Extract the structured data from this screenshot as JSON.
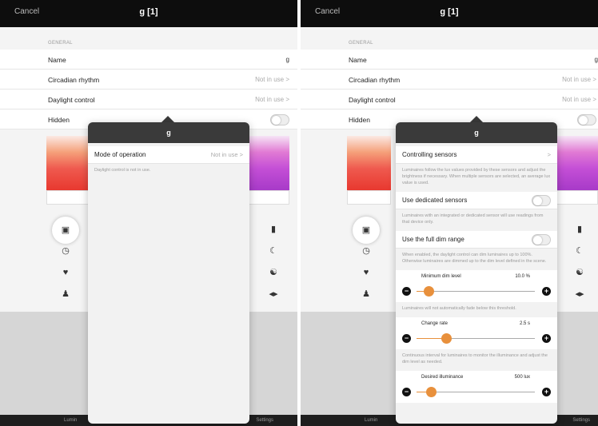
{
  "screens": [
    {
      "cancel": "Cancel",
      "title": "g [1]",
      "section": "GENERAL",
      "rows": [
        {
          "label": "Name",
          "value": "g"
        },
        {
          "label": "Circadian rhythm",
          "value": "Not in use >"
        },
        {
          "label": "Daylight control",
          "value": "Not in use >"
        },
        {
          "label": "Hidden",
          "value": ""
        }
      ],
      "tabs": {
        "left": "Lumin",
        "right": "Settings"
      },
      "popover": {
        "title": "g",
        "mode_label": "Mode of operation",
        "mode_value": "Not in use >",
        "note": "Daylight control is not in use."
      }
    },
    {
      "cancel": "Cancel",
      "title": "g [1]",
      "section": "GENERAL",
      "rows": [
        {
          "label": "Name",
          "value": "g"
        },
        {
          "label": "Circadian rhythm",
          "value": "Not in use >"
        },
        {
          "label": "Daylight control",
          "value": "Not in use >"
        },
        {
          "label": "Hidden",
          "value": ""
        }
      ],
      "tabs": {
        "left": "Lumin",
        "right": "Settings"
      },
      "popover": {
        "title": "g",
        "controlling_sensors": {
          "label": "Controlling sensors",
          "chevron": ">"
        },
        "controlling_desc": "Luminaires follow the lux values provided by these sensors and adjust the brightness if necessary. When multiple sensors are selected, an average lux value is used.",
        "dedicated": {
          "label": "Use dedicated sensors",
          "on": false
        },
        "dedicated_desc": "Luminaires with an integrated or dedicated sensor will use readings from that device only.",
        "full_dim": {
          "label": "Use the full dim range",
          "on": false
        },
        "full_dim_desc": "When enabled, the daylight control can dim luminaires up to 100%. Otherwise luminaires are dimmed up to the dim level defined in the scene.",
        "sliders": [
          {
            "label": "Minimum dim level",
            "value": "10.0 %",
            "fraction": 0.1,
            "desc": "Luminaires will not automatically fade below this threshold."
          },
          {
            "label": "Change rate",
            "value": "2.5 s",
            "fraction": 0.25,
            "desc": "Continuous interval for luminaires to monitor the illuminance and adjust the dim level as needed."
          },
          {
            "label": "Desired illuminance",
            "value": "500 lux",
            "fraction": 0.12,
            "desc": ""
          }
        ]
      }
    }
  ],
  "icons": {
    "left": [
      "scene-icon",
      "clock-icon",
      "mask-icon",
      "person-icon"
    ],
    "right": [
      "book-icon",
      "moon-icon",
      "yin-yang-icon",
      "sound-icon"
    ]
  },
  "colors": {
    "accent": "#e8903c",
    "header": "#0d0d0d",
    "popover_header": "#3a3a3a"
  }
}
